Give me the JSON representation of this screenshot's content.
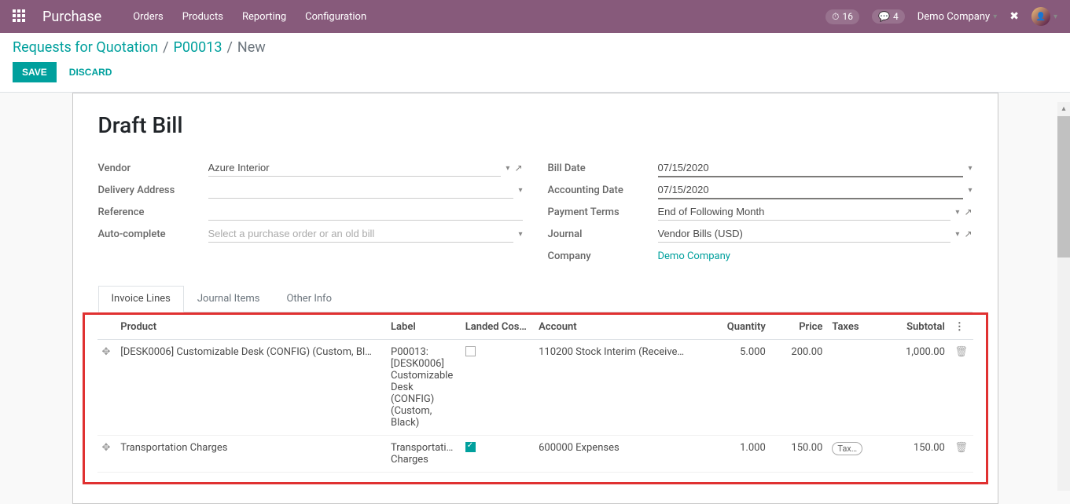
{
  "navbar": {
    "brand": "Purchase",
    "menu": [
      "Orders",
      "Products",
      "Reporting",
      "Configuration"
    ],
    "clock_badge": "16",
    "chat_badge": "4",
    "company": "Demo Company"
  },
  "breadcrumb": {
    "root": "Requests for Quotation",
    "mid": "P00013",
    "leaf": "New"
  },
  "buttons": {
    "save": "SAVE",
    "discard": "DISCARD"
  },
  "title": "Draft Bill",
  "form": {
    "vendor_label": "Vendor",
    "vendor": "Azure Interior",
    "delivery_label": "Delivery Address",
    "delivery": "",
    "reference_label": "Reference",
    "reference": "",
    "auto_label": "Auto-complete",
    "auto_placeholder": "Select a purchase order or an old bill",
    "billdate_label": "Bill Date",
    "billdate": "07/15/2020",
    "acctdate_label": "Accounting Date",
    "acctdate": "07/15/2020",
    "terms_label": "Payment Terms",
    "terms": "End of Following Month",
    "journal_label": "Journal",
    "journal": "Vendor Bills (USD)",
    "company_label": "Company",
    "company": "Demo Company"
  },
  "tabs": {
    "t1": "Invoice Lines",
    "t2": "Journal Items",
    "t3": "Other Info"
  },
  "columns": {
    "product": "Product",
    "label": "Label",
    "landed": "Landed Cos…",
    "account": "Account",
    "qty": "Quantity",
    "price": "Price",
    "taxes": "Taxes",
    "subtotal": "Subtotal"
  },
  "lines": [
    {
      "product": "[DESK0006] Customizable Desk (CONFIG) (Custom, Bl…",
      "label": "P00013: [DESK0006] Customizable Desk (CONFIG) (Custom, Black)",
      "landed": false,
      "account": "110200 Stock Interim (Receive…",
      "qty": "5.000",
      "price": "200.00",
      "taxes": "",
      "subtotal": "1,000.00"
    },
    {
      "product": "Transportation Charges",
      "label": "Transportati… Charges",
      "landed": true,
      "account": "600000 Expenses",
      "qty": "1.000",
      "price": "150.00",
      "taxes": "Tax…",
      "subtotal": "150.00"
    }
  ]
}
